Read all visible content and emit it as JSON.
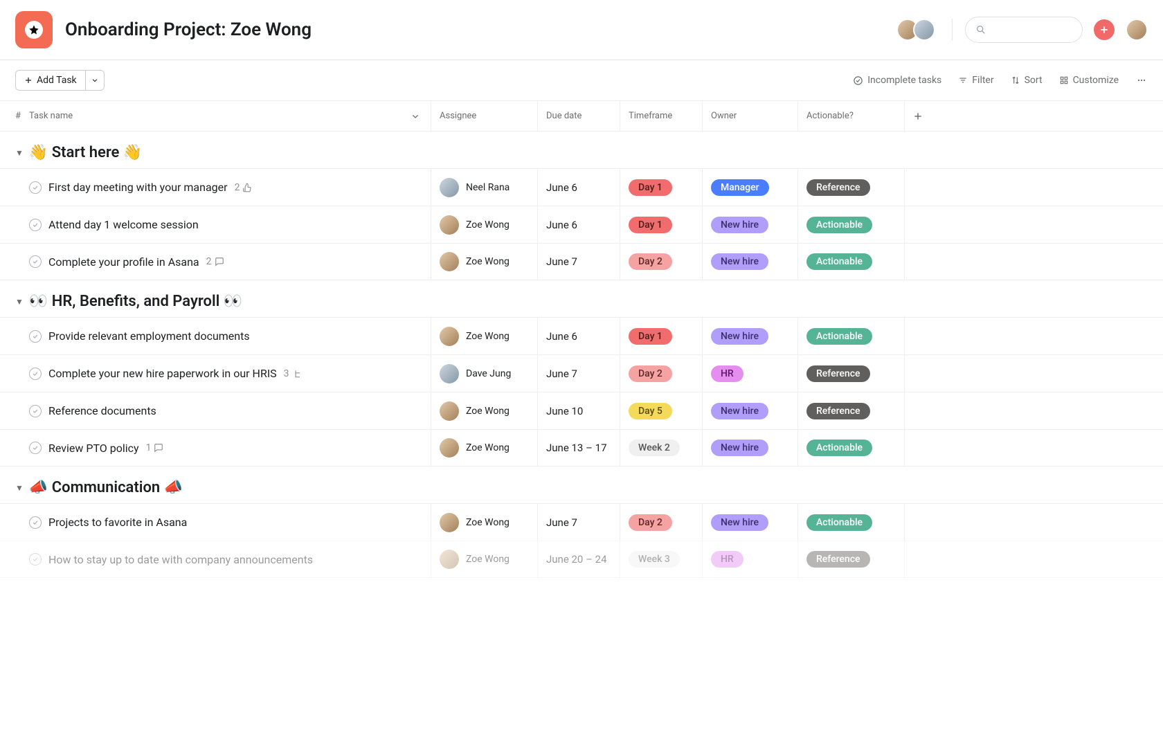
{
  "header": {
    "title": "Onboarding Project: Zoe Wong"
  },
  "toolbar": {
    "add_task": "Add Task",
    "incomplete": "Incomplete tasks",
    "filter": "Filter",
    "sort": "Sort",
    "customize": "Customize"
  },
  "columns": {
    "num": "#",
    "task": "Task name",
    "assignee": "Assignee",
    "due": "Due date",
    "timeframe": "Timeframe",
    "owner": "Owner",
    "actionable": "Actionable?"
  },
  "pill_labels": {
    "day1": "Day 1",
    "day2": "Day 2",
    "day5": "Day 5",
    "week2": "Week 2",
    "week3": "Week 3",
    "manager": "Manager",
    "newhire": "New hire",
    "hr": "HR",
    "reference": "Reference",
    "actionable": "Actionable"
  },
  "sections": [
    {
      "title": "👋 Start here 👋",
      "tasks": [
        {
          "name": "First day meeting with your manager",
          "meta_count": "2",
          "meta_icon": "like",
          "assignee": "Neel Rana",
          "avatar": "b",
          "due": "June 6",
          "timeframe": "day1",
          "owner": "manager",
          "actionable": "reference"
        },
        {
          "name": "Attend day 1 welcome session",
          "assignee": "Zoe Wong",
          "avatar": "a",
          "due": "June 6",
          "timeframe": "day1",
          "owner": "newhire",
          "actionable": "actionable"
        },
        {
          "name": "Complete your profile in Asana",
          "meta_count": "2",
          "meta_icon": "comment",
          "assignee": "Zoe Wong",
          "avatar": "a",
          "due": "June 7",
          "timeframe": "day2",
          "owner": "newhire",
          "actionable": "actionable"
        }
      ]
    },
    {
      "title": "👀 HR, Benefits, and Payroll 👀",
      "tasks": [
        {
          "name": "Provide relevant employment documents",
          "assignee": "Zoe Wong",
          "avatar": "a",
          "due": "June 6",
          "timeframe": "day1",
          "owner": "newhire",
          "actionable": "actionable"
        },
        {
          "name": "Complete your new hire paperwork in our HRIS",
          "meta_count": "3",
          "meta_icon": "subtask",
          "assignee": "Dave Jung",
          "avatar": "b",
          "due": "June 7",
          "timeframe": "day2",
          "owner": "hr",
          "actionable": "reference"
        },
        {
          "name": "Reference documents",
          "assignee": "Zoe Wong",
          "avatar": "a",
          "due": "June 10",
          "timeframe": "day5",
          "owner": "newhire",
          "actionable": "reference"
        },
        {
          "name": "Review PTO policy",
          "meta_count": "1",
          "meta_icon": "comment",
          "assignee": "Zoe Wong",
          "avatar": "a",
          "due": "June 13 – 17",
          "timeframe": "week2",
          "owner": "newhire",
          "actionable": "actionable"
        }
      ]
    },
    {
      "title": "📣 Communication 📣",
      "tasks": [
        {
          "name": "Projects to favorite in Asana",
          "assignee": "Zoe Wong",
          "avatar": "a",
          "due": "June 7",
          "timeframe": "day2",
          "owner": "newhire",
          "actionable": "actionable"
        },
        {
          "name": "How to stay up to date with company announcements",
          "assignee": "Zoe Wong",
          "avatar": "a",
          "due": "June 20 – 24",
          "timeframe": "week3",
          "owner": "hr",
          "actionable": "reference",
          "faded": true
        }
      ]
    }
  ]
}
